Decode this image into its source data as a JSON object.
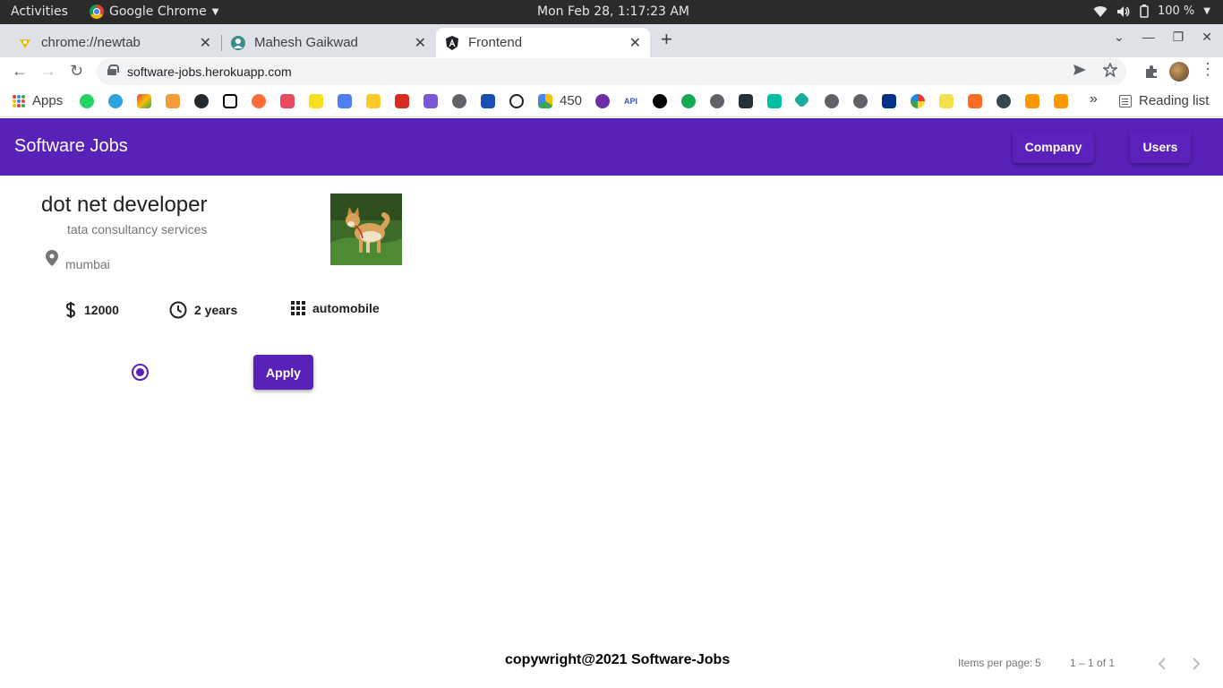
{
  "system": {
    "activities": "Activities",
    "app_name": "Google Chrome",
    "clock": "Mon Feb 28,  1:17:23 AM",
    "battery": "100 %"
  },
  "tabs": [
    {
      "title": "chrome://newtab"
    },
    {
      "title": "Mahesh Gaikwad"
    },
    {
      "title": "Frontend",
      "active": true
    }
  ],
  "address_bar": {
    "url": "software-jobs.herokuapp.com"
  },
  "bookmarks": {
    "apps_label": "Apps",
    "count_label": "450",
    "api_label": "API",
    "more_label": "»",
    "reading_list": "Reading list"
  },
  "header": {
    "title": "Software Jobs",
    "company_button": "Company",
    "users_button": "Users",
    "color": "#5822b9"
  },
  "job": {
    "title": "dot net developer",
    "company": "tata consultancy services",
    "location": "mumbai",
    "salary": "12000",
    "experience": "2 years",
    "category": "automobile",
    "apply_label": "Apply",
    "radio_selected": true
  },
  "footer": {
    "copyright": "copywright@2021 Software-Jobs",
    "items_per_page_label": "Items per page:",
    "items_per_page": "5",
    "range": "1 – 1 of 1"
  },
  "icons": {
    "prev_page": "chevron-left-icon",
    "next_page": "chevron-right-icon",
    "salary": "dollar-icon",
    "experience": "clock-icon",
    "category": "apps-grid-icon",
    "location": "location-pin-icon"
  }
}
